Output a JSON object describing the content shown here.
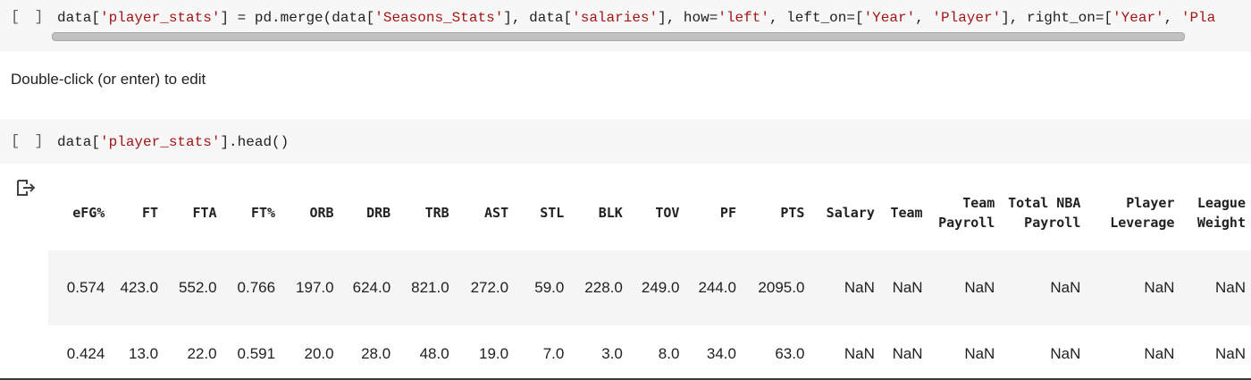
{
  "cell1": {
    "run_bracket": "[ ]",
    "code_parts": {
      "p1": "data[",
      "s1": "'player_stats'",
      "p2": "] = pd.merge(data[",
      "s2": "'Seasons_Stats'",
      "p3": "], data[",
      "s3": "'salaries'",
      "p4": "], how=",
      "s4": "'left'",
      "p5": ", left_on=[",
      "s5": "'Year'",
      "p6": ", ",
      "s6": "'Player'",
      "p7": "], right_on=[",
      "s7": "'Year'",
      "p8": ", ",
      "s8": "'Player"
    }
  },
  "textcell": {
    "text": "Double-click (or enter) to edit"
  },
  "cell2": {
    "run_bracket": "[ ]",
    "code_parts": {
      "p1": "data[",
      "s1": "'player_stats'",
      "p2": "].head()"
    }
  },
  "output": {
    "icon": "output-arrow-icon",
    "headers": [
      "eFG%",
      "FT",
      "FTA",
      "FT%",
      "ORB",
      "DRB",
      "TRB",
      "AST",
      "STL",
      "BLK",
      "TOV",
      "PF",
      "PTS",
      "Salary",
      "Team",
      "Team Payroll",
      "Total NBA Payroll",
      "Player Leverage",
      "League Weight"
    ],
    "rows": [
      [
        "0.574",
        "423.0",
        "552.0",
        "0.766",
        "197.0",
        "624.0",
        "821.0",
        "272.0",
        "59.0",
        "228.0",
        "249.0",
        "244.0",
        "2095.0",
        "NaN",
        "NaN",
        "NaN",
        "NaN",
        "NaN",
        "NaN"
      ],
      [
        "0.424",
        "13.0",
        "22.0",
        "0.591",
        "20.0",
        "28.0",
        "48.0",
        "19.0",
        "7.0",
        "3.0",
        "8.0",
        "34.0",
        "63.0",
        "NaN",
        "NaN",
        "NaN",
        "NaN",
        "NaN",
        "NaN"
      ]
    ]
  },
  "colors": {
    "string": "#a31515",
    "cell_bg": "#f7f7f7",
    "row_alt": "#f5f5f5"
  }
}
